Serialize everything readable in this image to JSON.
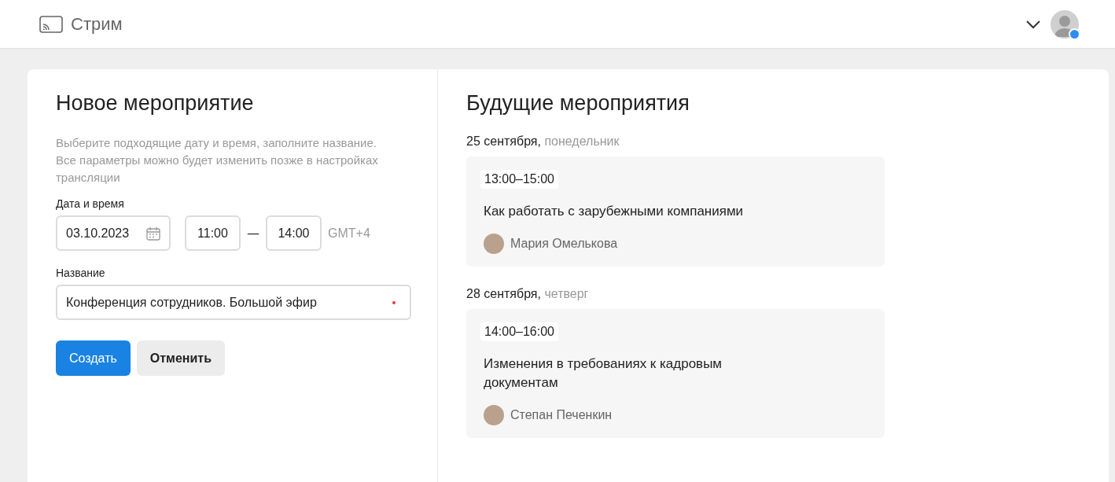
{
  "header": {
    "title": "Стрим",
    "user": {
      "online": true
    }
  },
  "form": {
    "title": "Новое мероприятие",
    "description": "Выберите подходящие дату и время, заполните название. Все параметры можно будет изменить позже в настройках трансляции",
    "datetime_label": "Дата и время",
    "date": "03.10.2023",
    "time_from": "11:00",
    "separator": "—",
    "time_to": "14:00",
    "timezone": "GMT+4",
    "name_label": "Название",
    "name_value": "Конференция сотрудников. Большой эфир",
    "name_required": true,
    "buttons": [
      {
        "label": "Создать",
        "kind": "primary"
      },
      {
        "label": "Отменить",
        "kind": "secondary"
      }
    ]
  },
  "upcoming": {
    "title": "Будущие мероприятия",
    "days": [
      {
        "date": "25 сентября,",
        "weekday": "понедельник",
        "events": [
          {
            "time": "13:00–15:00",
            "title": "Как работать с зарубежными компаниями",
            "speaker": "Мария Омелькова"
          }
        ]
      },
      {
        "date": "28 сентября,",
        "weekday": "четверг",
        "events": [
          {
            "time": "14:00–16:00",
            "title": "Изменения в требованиях к кадровым документам",
            "speaker": "Степан Печенкин"
          }
        ]
      }
    ]
  }
}
